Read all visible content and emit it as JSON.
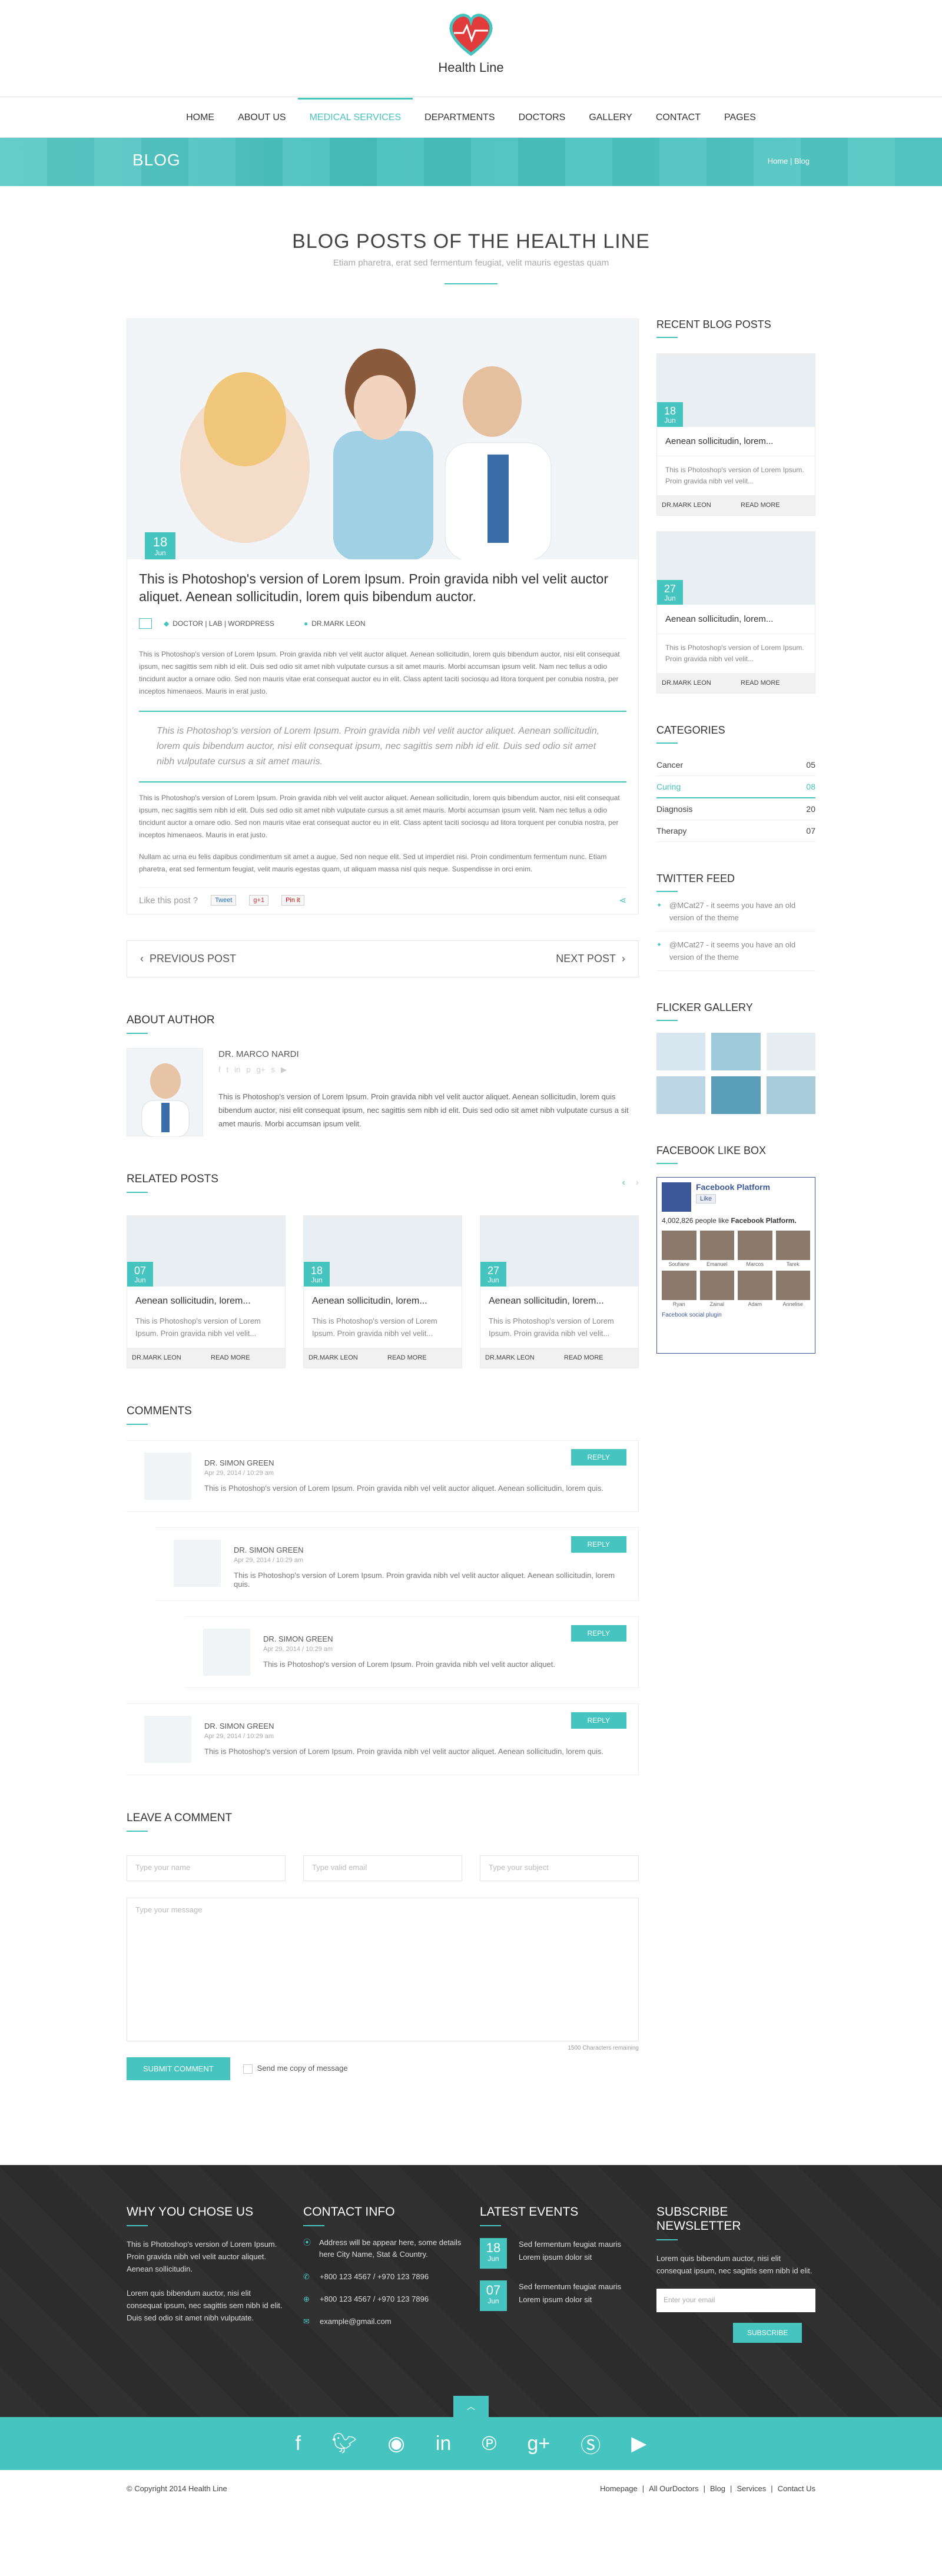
{
  "brand": {
    "name": "Health Line",
    "accent": "#45c4c0"
  },
  "nav": [
    "HOME",
    "ABOUT US",
    "MEDICAL SERVICES",
    "DEPARTMENTS",
    "DOCTORS",
    "GALLERY",
    "CONTACT",
    "PAGES"
  ],
  "nav_active": "MEDICAL SERVICES",
  "banner": {
    "title": "BLOG",
    "breadcrumb": "Home | Blog"
  },
  "section": {
    "title": "BLOG POSTS OF THE HEALTH LINE",
    "subtitle": "Etiam pharetra, erat sed fermentum feugiat, velit mauris egestas quam"
  },
  "post": {
    "day": "18",
    "month": "Jun",
    "title": "This is Photoshop's version  of Lorem Ipsum. Proin gravida nibh vel velit auctor aliquet. Aenean sollicitudin, lorem quis bibendum auctor.",
    "categories": "DOCTOR  |  LAB  |  WORDPRESS",
    "author": "DR.MARK LEON",
    "para1": "This is Photoshop's version of Lorem Ipsum. Proin gravida nibh vel velit auctor aliquet. Aenean sollicitudin, lorem quis bibendum auctor, nisi elit consequat ipsum, nec sagittis sem nibh id elit. Duis sed odio sit amet nibh vulputate cursus a sit amet mauris. Morbi accumsan ipsum velit. Nam nec tellus a odio tincidunt auctor a ornare odio. Sed non  mauris vitae erat consequat auctor eu in elit. Class aptent taciti sociosqu ad litora torquent per conubia nostra, per inceptos himenaeos. Mauris in erat justo.",
    "quote": "This is Photoshop's version  of Lorem Ipsum. Proin gravida nibh vel velit auctor aliquet. Aenean sollicitudin, lorem quis bibendum auctor, nisi elit consequat ipsum, nec sagittis sem nibh id elit. Duis sed odio sit amet nibh vulputate cursus a sit amet mauris.",
    "para2": "This is Photoshop's version of Lorem Ipsum. Proin gravida nibh vel velit auctor aliquet. Aenean sollicitudin, lorem quis bibendum auctor, nisi elit consequat ipsum, nec sagittis sem nibh id elit. Duis sed odio sit amet nibh vulputate cursus a sit amet mauris. Morbi accumsan ipsum velit. Nam nec tellus a odio tincidunt auctor a ornare odio. Sed non  mauris vitae erat consequat auctor eu in elit. Class aptent taciti sociosqu ad litora torquent per conubia nostra, per inceptos himenaeos. Mauris in erat justo.",
    "para3": "Nullam ac urna eu felis dapibus condimentum sit amet a augue. Sed non neque elit. Sed ut imperdiet nisi. Proin condimentum fermentum nunc. Etiam pharetra, erat sed fermentum feugiat, velit mauris egestas quam, ut aliquam massa nisl quis neque. Suspendisse in orci enim.",
    "like": "Like this post ?",
    "tweet": "Tweet",
    "gplus": "g+1",
    "pin": "Pin it"
  },
  "pager": {
    "prev": "PREVIOUS POST",
    "next": "NEXT POST"
  },
  "about": {
    "title": "ABOUT AUTHOR",
    "name": "DR. MARCO NARDI",
    "text": "This is Photoshop's version  of Lorem Ipsum. Proin gravida nibh vel velit auctor aliquet. Aenean sollicitudin, lorem quis bibendum auctor, nisi elit consequat ipsum, nec sagittis sem nibh id elit. Duis sed odio sit amet nibh vulputate cursus a sit amet mauris. Morbi accumsan ipsum velit."
  },
  "related": {
    "title": "RELATED POSTS",
    "items": [
      {
        "day": "07",
        "month": "Jun",
        "title": "Aenean sollicitudin, lorem...",
        "text": "This is Photoshop's version  of Lorem Ipsum. Proin gravida nibh vel velit...",
        "author": "DR.MARK LEON",
        "more": "READ MORE"
      },
      {
        "day": "18",
        "month": "Jun",
        "title": "Aenean sollicitudin, lorem...",
        "text": "This is Photoshop's version  of Lorem Ipsum. Proin gravida nibh vel velit...",
        "author": "DR.MARK LEON",
        "more": "READ MORE"
      },
      {
        "day": "27",
        "month": "Jun",
        "title": "Aenean sollicitudin, lorem...",
        "text": "This is Photoshop's version  of Lorem Ipsum. Proin gravida nibh vel velit...",
        "author": "DR.MARK LEON",
        "more": "READ MORE"
      }
    ]
  },
  "comments": {
    "title": "COMMENTS",
    "reply": "REPLY",
    "items": [
      {
        "name": "DR. SIMON GREEN",
        "date": "Apr 29, 2014 / 10:29 am",
        "text": "This is Photoshop's version  of Lorem Ipsum. Proin gravida nibh vel velit auctor aliquet. Aenean sollicitudin, lorem quis."
      },
      {
        "name": "DR. SIMON GREEN",
        "date": "Apr 29, 2014 / 10:29 am",
        "text": "This is Photoshop's version  of Lorem Ipsum. Proin gravida nibh vel velit auctor aliquet. Aenean sollicitudin, lorem quis."
      },
      {
        "name": "DR. SIMON GREEN",
        "date": "Apr 29, 2014 / 10:29 am",
        "text": "This is Photoshop's version  of Lorem Ipsum. Proin gravida nibh vel velit auctor aliquet."
      },
      {
        "name": "DR. SIMON GREEN",
        "date": "Apr 29, 2014 / 10:29 am",
        "text": "This is Photoshop's version  of Lorem Ipsum. Proin gravida nibh vel velit auctor aliquet. Aenean sollicitudin, lorem quis."
      }
    ]
  },
  "form": {
    "title": "LEAVE A COMMENT",
    "name": "Type your name",
    "email": "Type valid email",
    "subject": "Type your subject",
    "message": "Type your message",
    "remaining": "1500 Characters remaining",
    "submit": "SUBMIT COMMENT",
    "copy": "Send me copy of message"
  },
  "sidebar": {
    "recent_title": "RECENT BLOG POSTS",
    "recent": [
      {
        "day": "18",
        "month": "Jun",
        "title": "Aenean sollicitudin, lorem...",
        "text": "This is Photoshop's version  of Lorem Ipsum. Proin gravida nibh vel velit...",
        "author": "DR.MARK LEON",
        "more": "READ MORE"
      },
      {
        "day": "27",
        "month": "Jun",
        "title": "Aenean sollicitudin, lorem...",
        "text": "This is Photoshop's version  of Lorem Ipsum. Proin gravida nibh vel velit...",
        "author": "DR.MARK LEON",
        "more": "READ MORE"
      }
    ],
    "categories_title": "CATEGORIES",
    "categories": [
      {
        "name": "Cancer",
        "count": "05"
      },
      {
        "name": "Curing",
        "count": "08"
      },
      {
        "name": "Diagnosis",
        "count": "20"
      },
      {
        "name": "Therapy",
        "count": "07"
      }
    ],
    "twitter_title": "TWITTER FEED",
    "tweets": [
      "@MCat27 - it seems you have an old version of the theme",
      "@MCat27 - it seems you have an old version of the theme"
    ],
    "gallery_title": "FLICKER GALLERY",
    "fb_title": "FACEBOOK LIKE BOX",
    "fb": {
      "name": "Facebook Platform",
      "like": "Like",
      "count_text": "4,002,826 people like",
      "count_page": "Facebook Platform.",
      "faces": [
        "Soufiane",
        "Emanuel",
        "Marcos",
        "Tarek",
        "Ryan",
        "Zainal",
        "Adam",
        "Annelise"
      ],
      "plugin": "Facebook social plugin"
    }
  },
  "footer": {
    "why_title": "WHY YOU CHOSE US",
    "why_text1": "This is Photoshop's version  of Lorem Ipsum. Proin gravida nibh vel velit auctor aliquet. Aenean sollicitudin.",
    "why_text2": "Lorem quis bibendum auctor, nisi elit consequat ipsum, nec sagittis sem nibh id elit. Duis sed odio sit amet nibh vulputate.",
    "contact_title": "CONTACT INFO",
    "address": "Address will be appear here, some details here City Name, Stat & Country.",
    "phone1": "+800 123 4567  /  +970 123 7896",
    "phone2": "+800 123 4567  /  +970 123 7896",
    "email": "example@gmail.com",
    "events_title": "LATEST EVENTS",
    "events": [
      {
        "day": "18",
        "month": "Jun",
        "title": "Sed fermentum feugiat mauris",
        "place": "Lorem ipsum dolor sit"
      },
      {
        "day": "07",
        "month": "Jun",
        "title": "Sed fermentum feugiat mauris",
        "place": "Lorem ipsum dolor sit"
      }
    ],
    "subscribe_title": "SUBSCRIBE NEWSLETTER",
    "subscribe_text": "Lorem quis bibendum auctor, nisi elit consequat ipsum, nec sagittis sem nibh id elit.",
    "subscribe_placeholder": "Enter your email",
    "subscribe_btn": "SUBSCRIBE"
  },
  "copyright": "© Copyright 2014 Health Line",
  "bottom_links": [
    "Homepage",
    "All OurDoctors",
    "Blog",
    "Services",
    "Contact Us"
  ]
}
